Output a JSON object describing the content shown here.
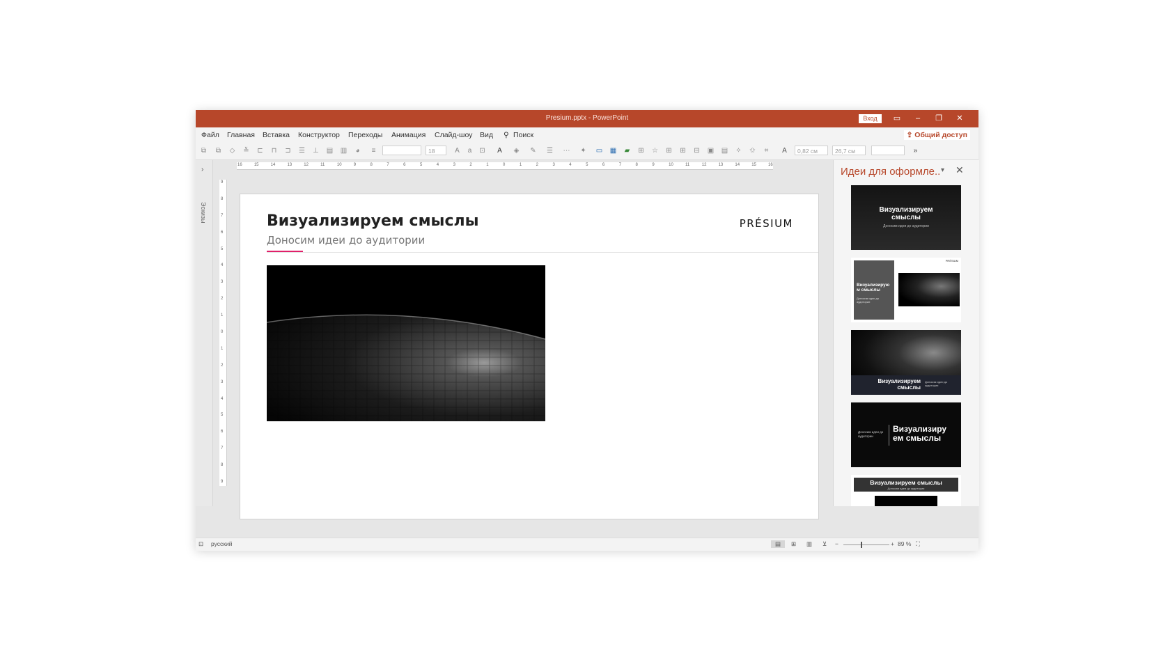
{
  "window": {
    "title": "Presium.pptx  -  PowerPoint",
    "signin_label": "Вход",
    "share_label": "Общий доступ"
  },
  "menu": [
    "Файл",
    "Главная",
    "Вставка",
    "Конструктор",
    "Переходы",
    "Анимация",
    "Слайд-шоу",
    "Вид",
    "Поиск"
  ],
  "toolbar": {
    "font_size": "18",
    "width_value": "0,82 см",
    "height_value": "26,7 см"
  },
  "left_pane": {
    "label": "Эскизы"
  },
  "ruler": {
    "h_ticks": [
      "16",
      "15",
      "14",
      "13",
      "12",
      "11",
      "10",
      "9",
      "8",
      "7",
      "6",
      "5",
      "4",
      "3",
      "2",
      "1",
      "0",
      "1",
      "2",
      "3",
      "4",
      "5",
      "6",
      "7",
      "8",
      "9",
      "10",
      "11",
      "12",
      "13",
      "14",
      "15",
      "16"
    ],
    "v_ticks": [
      "9",
      "8",
      "7",
      "6",
      "5",
      "4",
      "3",
      "2",
      "1",
      "0",
      "1",
      "2",
      "3",
      "4",
      "5",
      "6",
      "7",
      "8",
      "9"
    ]
  },
  "slide": {
    "title": "Визуализируем смыслы",
    "subtitle": "Доносим идеи до аудитории",
    "logo": "PRÉSIUM"
  },
  "design_pane": {
    "title": "Идеи для оформле..",
    "thumbs": [
      {
        "title": "Визуализируем смыслы",
        "sub": "Доносим идеи до аудитории"
      },
      {
        "title": "Визуализирую м смыслы",
        "sub": "Доносим идеи до аудитории",
        "logo": "PRÉSIUM"
      },
      {
        "title": "Визуализируем смыслы",
        "sub": "Доносим идеи до аудитории"
      },
      {
        "title": "Визуализиру ем смыслы",
        "sub": "Доносим идеи до аудитории"
      },
      {
        "title": "Визуализируем смыслы",
        "sub": "Доносим идеи до аудитории"
      }
    ]
  },
  "status": {
    "language": "русский",
    "zoom": "89 %"
  },
  "colors": {
    "accent": "#b7472a",
    "slide_accent_line": "#e0206a"
  }
}
